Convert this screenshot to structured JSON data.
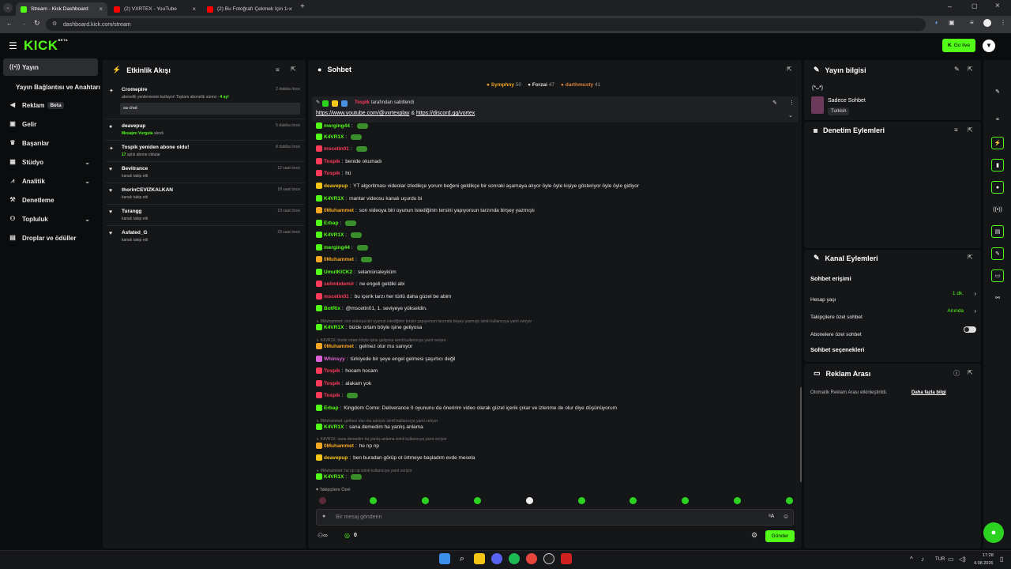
{
  "browser": {
    "tabs": [
      {
        "label": "Stream - Kick Dashboard",
        "icon": "kick-icon",
        "active": true
      },
      {
        "label": "(2) VXRTEX - YouTube",
        "icon": "youtube-icon",
        "active": false
      },
      {
        "label": "(2) Bu Fotoğrafı Çekmek İçin 14",
        "icon": "youtube-icon",
        "active": false
      }
    ],
    "url": "dashboard.kick.com/stream"
  },
  "header": {
    "logo": "KICK",
    "logo_sup": "BETA",
    "go_live": "Go live"
  },
  "sidebar": {
    "items": [
      {
        "label": "Yayın",
        "icon": "broadcast-icon",
        "active": true
      },
      {
        "label": "Yayın Bağlantısı ve Anahtarı",
        "icon": ""
      },
      {
        "label": "Reklam",
        "badge": "Beta",
        "icon": "megaphone-icon"
      },
      {
        "label": "Gelir",
        "icon": "money-icon"
      },
      {
        "label": "Başarılar",
        "icon": "trophy-icon"
      },
      {
        "label": "Stüdyo",
        "icon": "studio-icon",
        "chevron": true
      },
      {
        "label": "Analitik",
        "icon": "chart-icon",
        "chevron": true
      },
      {
        "label": "Denetleme",
        "icon": "hammer-icon"
      },
      {
        "label": "Topluluk",
        "icon": "community-icon",
        "chevron": true
      },
      {
        "label": "Droplar ve ödüller",
        "icon": "gift-icon"
      }
    ]
  },
  "activity": {
    "title": "Etkinlik Akışı",
    "items": [
      {
        "name": "Cromepire",
        "sub": "abonelik yenilemesini kutluyor! Toplam abonelik süresi -",
        "sub_hl": "4 ay!",
        "time": "2 dakika önce",
        "msg": "sa chat",
        "icon": "star-icon"
      },
      {
        "name": "deavepup",
        "sub_hl": "Mesajını Vurgula",
        "sub": "alındı",
        "time": "5 dakika önce",
        "icon": "points-icon"
      },
      {
        "name": "Tospik yeniden abone oldu!",
        "sub_hl": "17",
        "sub": "aylık abone oldular",
        "time": "8 dakika önce",
        "icon": "star-icon"
      },
      {
        "name": "Bevitrance",
        "sub": "kanalı takip etti",
        "time": "12 saat önce",
        "icon": "heart-icon"
      },
      {
        "name": "thorinCEVIZKALKAN",
        "sub": "kanalı takip etti",
        "time": "18 saat önce",
        "icon": "heart-icon"
      },
      {
        "name": "Turangg",
        "sub": "kanalı takip etti",
        "time": "19 saat önce",
        "icon": "heart-icon"
      },
      {
        "name": "Asfated_G",
        "sub": "kanalı takip etti",
        "time": "23 saat önce",
        "icon": "heart-icon"
      }
    ]
  },
  "chat": {
    "title": "Sohbet",
    "top_gifters": [
      {
        "name": "Symphny",
        "count": "50",
        "color": "#f5a623"
      },
      {
        "name": "Forzai",
        "count": "47",
        "color": "#cfcfcf"
      },
      {
        "name": "darthmusty",
        "count": "41",
        "color": "#d9823b"
      }
    ],
    "pinned": {
      "user": "Tospik",
      "by": "tarafından sabitlendi",
      "link1": "https://www.youtube.com/@vxrtexplay",
      "amp": "&",
      "link2": "https://discord.gg/vortex"
    },
    "messages": [
      {
        "type": "msg",
        "user": "merging44",
        "text": "",
        "color": "#53fc18"
      },
      {
        "type": "msg",
        "user": "K4VR1X",
        "text": "",
        "color": "#53fc18"
      },
      {
        "type": "msg",
        "user": "mscetin01",
        "text": "",
        "color": "#ff3b5c"
      },
      {
        "type": "msg",
        "user": "Tospik",
        "text": "benide okumadı",
        "color": "#ff3b5c"
      },
      {
        "type": "msg",
        "user": "Tospik",
        "text": "hü",
        "color": "#ff3b5c"
      },
      {
        "type": "msg",
        "user": "deavepup",
        "text": "YT algoritması videolar izledikçe yorum beğeni geldikçe bir sonraki aşamaya alıyor öyle öyle kişiye gösteriyor öyle öyle gidiyor",
        "color": "#f5c518"
      },
      {
        "type": "msg",
        "user": "K4VR1X",
        "text": "mantar videosu kanalı uçurdu bi",
        "color": "#53fc18"
      },
      {
        "type": "msg",
        "user": "0Muhammet",
        "text": "son videoya biri oyunun istediğinin tersini yapıyorsun tarzında birşey yazmıştı",
        "color": "#f5a623"
      },
      {
        "type": "msg",
        "user": "Erbap",
        "text": "",
        "color": "#53fc18"
      },
      {
        "type": "msg",
        "user": "K4VR1X",
        "text": "",
        "color": "#53fc18"
      },
      {
        "type": "msg",
        "user": "merging44",
        "text": "",
        "color": "#53fc18"
      },
      {
        "type": "msg",
        "user": "0Muhammet",
        "text": "",
        "color": "#f5a623"
      },
      {
        "type": "msg",
        "user": "UmutKICK2",
        "text": "selamünaleyküm",
        "color": "#53fc18"
      },
      {
        "type": "msg",
        "user": "selimbdemir",
        "text": "ne engeli geldiki abi",
        "color": "#ff3b5c"
      },
      {
        "type": "msg",
        "user": "mscetin01",
        "text": "bu içerik tarzı her türlü daha güzel be abim",
        "color": "#ff3b5c"
      },
      {
        "type": "msg",
        "user": "BotRix",
        "text": "@mscetin01, 1. seviyeye yükseldin.",
        "color": "#53fc18"
      },
      {
        "type": "reply",
        "text": "0Muhammet: son videoya biri oyunun istediğinin tersini yapıyorsun tarzında birşey yazmıştı isimli kullanıcıya yanıt veriyor"
      },
      {
        "type": "msg",
        "user": "K4VR1X",
        "text": "bizde ortam böyle işine geliyosa",
        "color": "#53fc18"
      },
      {
        "type": "reply",
        "text": "K4VR1X: bizde ortam böyle işine geliyosa isimli kullanıcıya yanıt veriyor"
      },
      {
        "type": "msg",
        "user": "0Muhammet",
        "text": "gelmez olur mu sanıyor",
        "color": "#f5a623"
      },
      {
        "type": "msg",
        "user": "Whinsyy",
        "text": "türkiyede bir şeye engel gelmesi şaşırtıcı değil",
        "color": "#e062d8"
      },
      {
        "type": "msg",
        "user": "Tospik",
        "text": "hocam hocam",
        "color": "#ff3b5c"
      },
      {
        "type": "msg",
        "user": "Tospik",
        "text": "alakam yok",
        "color": "#ff3b5c"
      },
      {
        "type": "msg",
        "user": "Tospik",
        "text": "",
        "color": "#ff3b5c"
      },
      {
        "type": "msg",
        "user": "Erbap",
        "text": "Kingdom Come: Deliverance II oyununu da öneririm video olarak güzel içerik çıkar ve izlenme de olur diye düşünüyorum",
        "color": "#53fc18"
      },
      {
        "type": "reply",
        "text": "0Muhammet: gelmez olur mu sanıyor isimli kullanıcıya yanıt veriyor"
      },
      {
        "type": "msg",
        "user": "K4VR1X",
        "text": "sana demedim ha yanlış anlama",
        "color": "#53fc18"
      },
      {
        "type": "reply",
        "text": "K4VR1X: sana demedim ha yanlış anlama isimli kullanıcıya yanıt veriyor"
      },
      {
        "type": "msg",
        "user": "0Muhammet",
        "text": "he np np",
        "color": "#f5a623"
      },
      {
        "type": "msg",
        "user": "deavepup",
        "text": "ben buradan görüp ot ürtmeye başladım evde mesela",
        "color": "#f5c518"
      },
      {
        "type": "reply",
        "text": "0Muhammet: he np np isimli kullanıcıya yanıt veriyor"
      },
      {
        "type": "msg",
        "user": "K4VR1X",
        "text": "",
        "color": "#53fc18"
      }
    ],
    "followers_only": "Takipçilere Özel",
    "input_placeholder": "Bir mesaj gönderin",
    "points": "0",
    "send": "Gönder"
  },
  "stream_info": {
    "title": "Yayın bilgisi",
    "face": "(*ᴗ*)",
    "stream_title": "Sadece Sohbet",
    "language": "Turkish"
  },
  "moderation": {
    "title": "Denetim Eylemleri"
  },
  "channel_actions": {
    "title": "Kanal Eylemleri",
    "section": "Sohbet erişimi",
    "rows": [
      {
        "label": "Hesap yaşı",
        "value": "1 dk."
      },
      {
        "label": "Takipçilere özel sohbet",
        "value": "Anında"
      },
      {
        "label": "Abonelere özel sohbet",
        "value": ""
      }
    ],
    "options": "Sohbet seçenekleri"
  },
  "ad_break": {
    "title": "Reklam Arası",
    "text": "Otomatik Reklam Arası etkinleştirildi.",
    "link": "Daha fazla bilgi"
  },
  "taskbar": {
    "lang": "TUR",
    "time": "17:28",
    "date": "4.08.2026"
  },
  "colors": {
    "accent": "#53fc18",
    "panel": "#151618",
    "bg": "#0b0c0d"
  }
}
